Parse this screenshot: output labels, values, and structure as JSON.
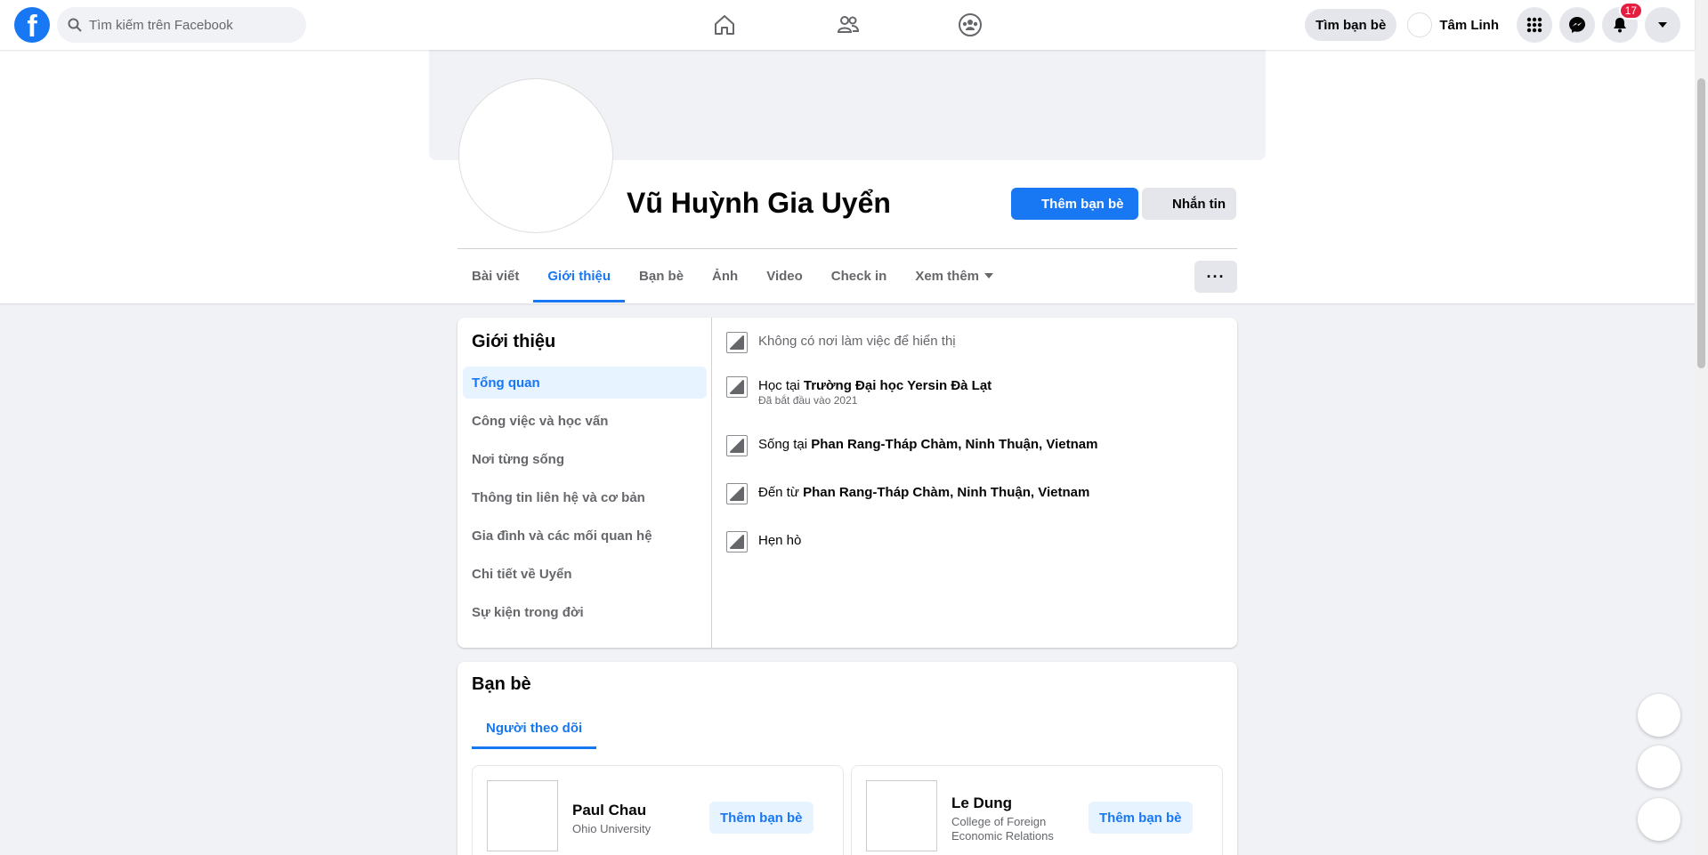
{
  "topnav": {
    "logo": "f",
    "search_placeholder": "Tìm kiếm trên Facebook",
    "find_friends": "Tìm bạn bè",
    "user_name": "Tâm Linh",
    "notification_count": "17"
  },
  "profile": {
    "name": "Vũ Huỳnh Gia Uyển",
    "add_friend": "Thêm bạn bè",
    "message": "Nhắn tin",
    "more": "···"
  },
  "tabs": [
    "Bài viết",
    "Giới thiệu",
    "Bạn bè",
    "Ảnh",
    "Video",
    "Check in",
    "Xem thêm"
  ],
  "about": {
    "title": "Giới thiệu",
    "menu": [
      "Tổng quan",
      "Công việc và học vấn",
      "Nơi từng sống",
      "Thông tin liên hệ và cơ bản",
      "Gia đình và các mối quan hệ",
      "Chi tiết về Uyển",
      "Sự kiện trong đời"
    ],
    "work": "Không có nơi làm việc để hiển thị",
    "study_prefix": "Học tại ",
    "study_place": "Trường Đại học Yersin Đà Lạt",
    "study_sub": "Đã bắt đầu vào 2021",
    "lives_prefix": "Sống tại ",
    "lives_place": "Phan Rang-Tháp Chàm, Ninh Thuận, Vietnam",
    "from_prefix": "Đến từ ",
    "from_place": "Phan Rang-Tháp Chàm, Ninh Thuận, Vietnam",
    "dating": "Hẹn hò"
  },
  "friends": {
    "title": "Bạn bè",
    "subtab": "Người theo dõi",
    "items": [
      {
        "name": "Paul Chau",
        "sub": "Ohio University",
        "button": "Thêm bạn bè"
      },
      {
        "name": "Le Dung",
        "sub": "College of Foreign Economic Relations",
        "button": "Thêm bạn bè"
      }
    ]
  }
}
